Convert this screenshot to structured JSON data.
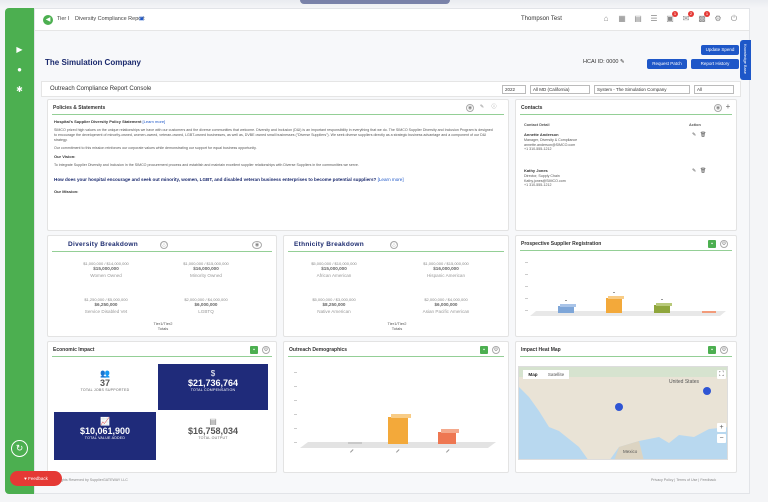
{
  "topbar": {
    "crumbs": [
      "Tier I",
      "Diversity Compliance Report"
    ],
    "user": "Thompson Test",
    "badges": [
      "1",
      "2",
      "1"
    ]
  },
  "company": "The Simulation Company",
  "hcai_label": "HCAI ID: 0000",
  "buttons": {
    "update_spend": "Update Spend",
    "request_patch": "Request Patch",
    "report_history": "Report History"
  },
  "console": {
    "title": "Outreach Compliance Report Console",
    "filters": [
      "2022",
      "All MD (California)",
      "System - The Simulation Company",
      "All"
    ]
  },
  "policies": {
    "title": "Policies & Statements",
    "statement_heading": "Hospital's Supplier Diversity Policy Statement",
    "learn_more": "[Learn more]",
    "para1": "SIMCO prized high values on the unique relationships we have with our customers and the diverse communities that welcome. Diversity and Inclusion (D&I) is an important responsibility in everything that we do. The SIMCO Supplier Diversity and Inclusion Program is designed to encourage the development of minority-owned, women-owned, veteran-owned, LGBT-owned businesses, as well as, DVBE owned small businesses (\"Diverse Suppliers\"). We seek diverse suppliers directly as a strategic business advantage and a component of our D&I strategy.",
    "para2": "Our commitment to this mission reinforces our corporate values while demonstrating our support for equal business opportunity.",
    "vision_label": "Our Vision:",
    "vision": "To integrate Supplier Diversity and Inclusion in the SIMCO procurement process and establish and maintain excellent supplier relationships with Diverse Suppliers in the communities we serve.",
    "question": "How does your hospital encourage and seek out minority, women, LGBT, and disabled veteran business enterprises to become potential suppliers?",
    "question_link": "[Learn more]",
    "mission_label": "Our Mission:"
  },
  "contacts": {
    "title": "Contacts",
    "col_contact": "Contact Detail",
    "col_action": "Action",
    "people": [
      {
        "name": "Annette Anderson",
        "lines": [
          "Manager, Diversity & Compliance",
          "annette.anderson@SIMCO.com",
          "+1 310-555-1212"
        ]
      },
      {
        "name": "Kathy Jones",
        "lines": [
          "Director, Supply Chain",
          "Kathy.jones@SIMCO.com",
          "+1 310-555-1212"
        ]
      }
    ]
  },
  "diversity": {
    "title": "Diversity Breakdown",
    "cells": [
      {
        "amt": "$1,000,000 / $14,000,000",
        "total": "$15,000,000",
        "label": "Women Owned"
      },
      {
        "amt": "$1,000,000 / $15,000,000",
        "total": "$16,000,000",
        "label": "Minority Owned"
      },
      {
        "amt": "$1,250,000 / $5,000,000",
        "total": "$6,250,000",
        "label": "Service Disabled Vet"
      },
      {
        "amt": "$2,000,000 / $4,000,000",
        "total": "$6,000,000",
        "label": "LGBTQ"
      }
    ],
    "tier_label": "Tier1/Tier2",
    "tier_sub": "Totals"
  },
  "ethnicity": {
    "title": "Ethnicity Breakdown",
    "cells": [
      {
        "amt": "$5,000,000 / $10,000,000",
        "total": "$15,000,000",
        "label": "African American"
      },
      {
        "amt": "$1,000,000 / $15,000,000",
        "total": "$16,000,000",
        "label": "Hispanic American"
      },
      {
        "amt": "$5,000,000 / $3,000,000",
        "total": "$8,250,000",
        "label": "Native American"
      },
      {
        "amt": "$2,000,000 / $4,000,000",
        "total": "$6,000,000",
        "label": "Asian Pacific American"
      }
    ],
    "tier_label": "Tier1/Tier2",
    "tier_sub": "Totals"
  },
  "prospective": {
    "title": "Prospective Supplier Registration"
  },
  "economic": {
    "title": "Economic Impact",
    "tiles": [
      {
        "icon": "people-icon",
        "value": "37",
        "label": "TOTAL JOBS SUPPORTED"
      },
      {
        "icon": "dollar-icon",
        "value": "$21,736,764",
        "label": "TOTAL COMPENSATION"
      },
      {
        "icon": "chart-icon",
        "value": "$10,061,900",
        "label": "TOTAL VALUE ADDED"
      },
      {
        "icon": "output-icon",
        "value": "$16,758,034",
        "label": "TOTAL OUTPUT"
      }
    ]
  },
  "outreach": {
    "title": "Outreach Demographics"
  },
  "heatmap": {
    "title": "Impact Heat Map",
    "tab_map": "Map",
    "tab_satellite": "Satellite",
    "map_labels": [
      "United States",
      "Mexico"
    ]
  },
  "footer": {
    "left": "© 2022 All Rights Reserved by SupplierGATEWAY LLC",
    "right": "Privacy Policy | Terms of Use | Feedback"
  },
  "feedback_btn": "Feedback",
  "side_tab": "Knowledge Base",
  "colors": {
    "green": "#4caf50",
    "navy": "#1b2a6e",
    "blue": "#1e57c8",
    "tile_navy": "#1f2b7a"
  }
}
